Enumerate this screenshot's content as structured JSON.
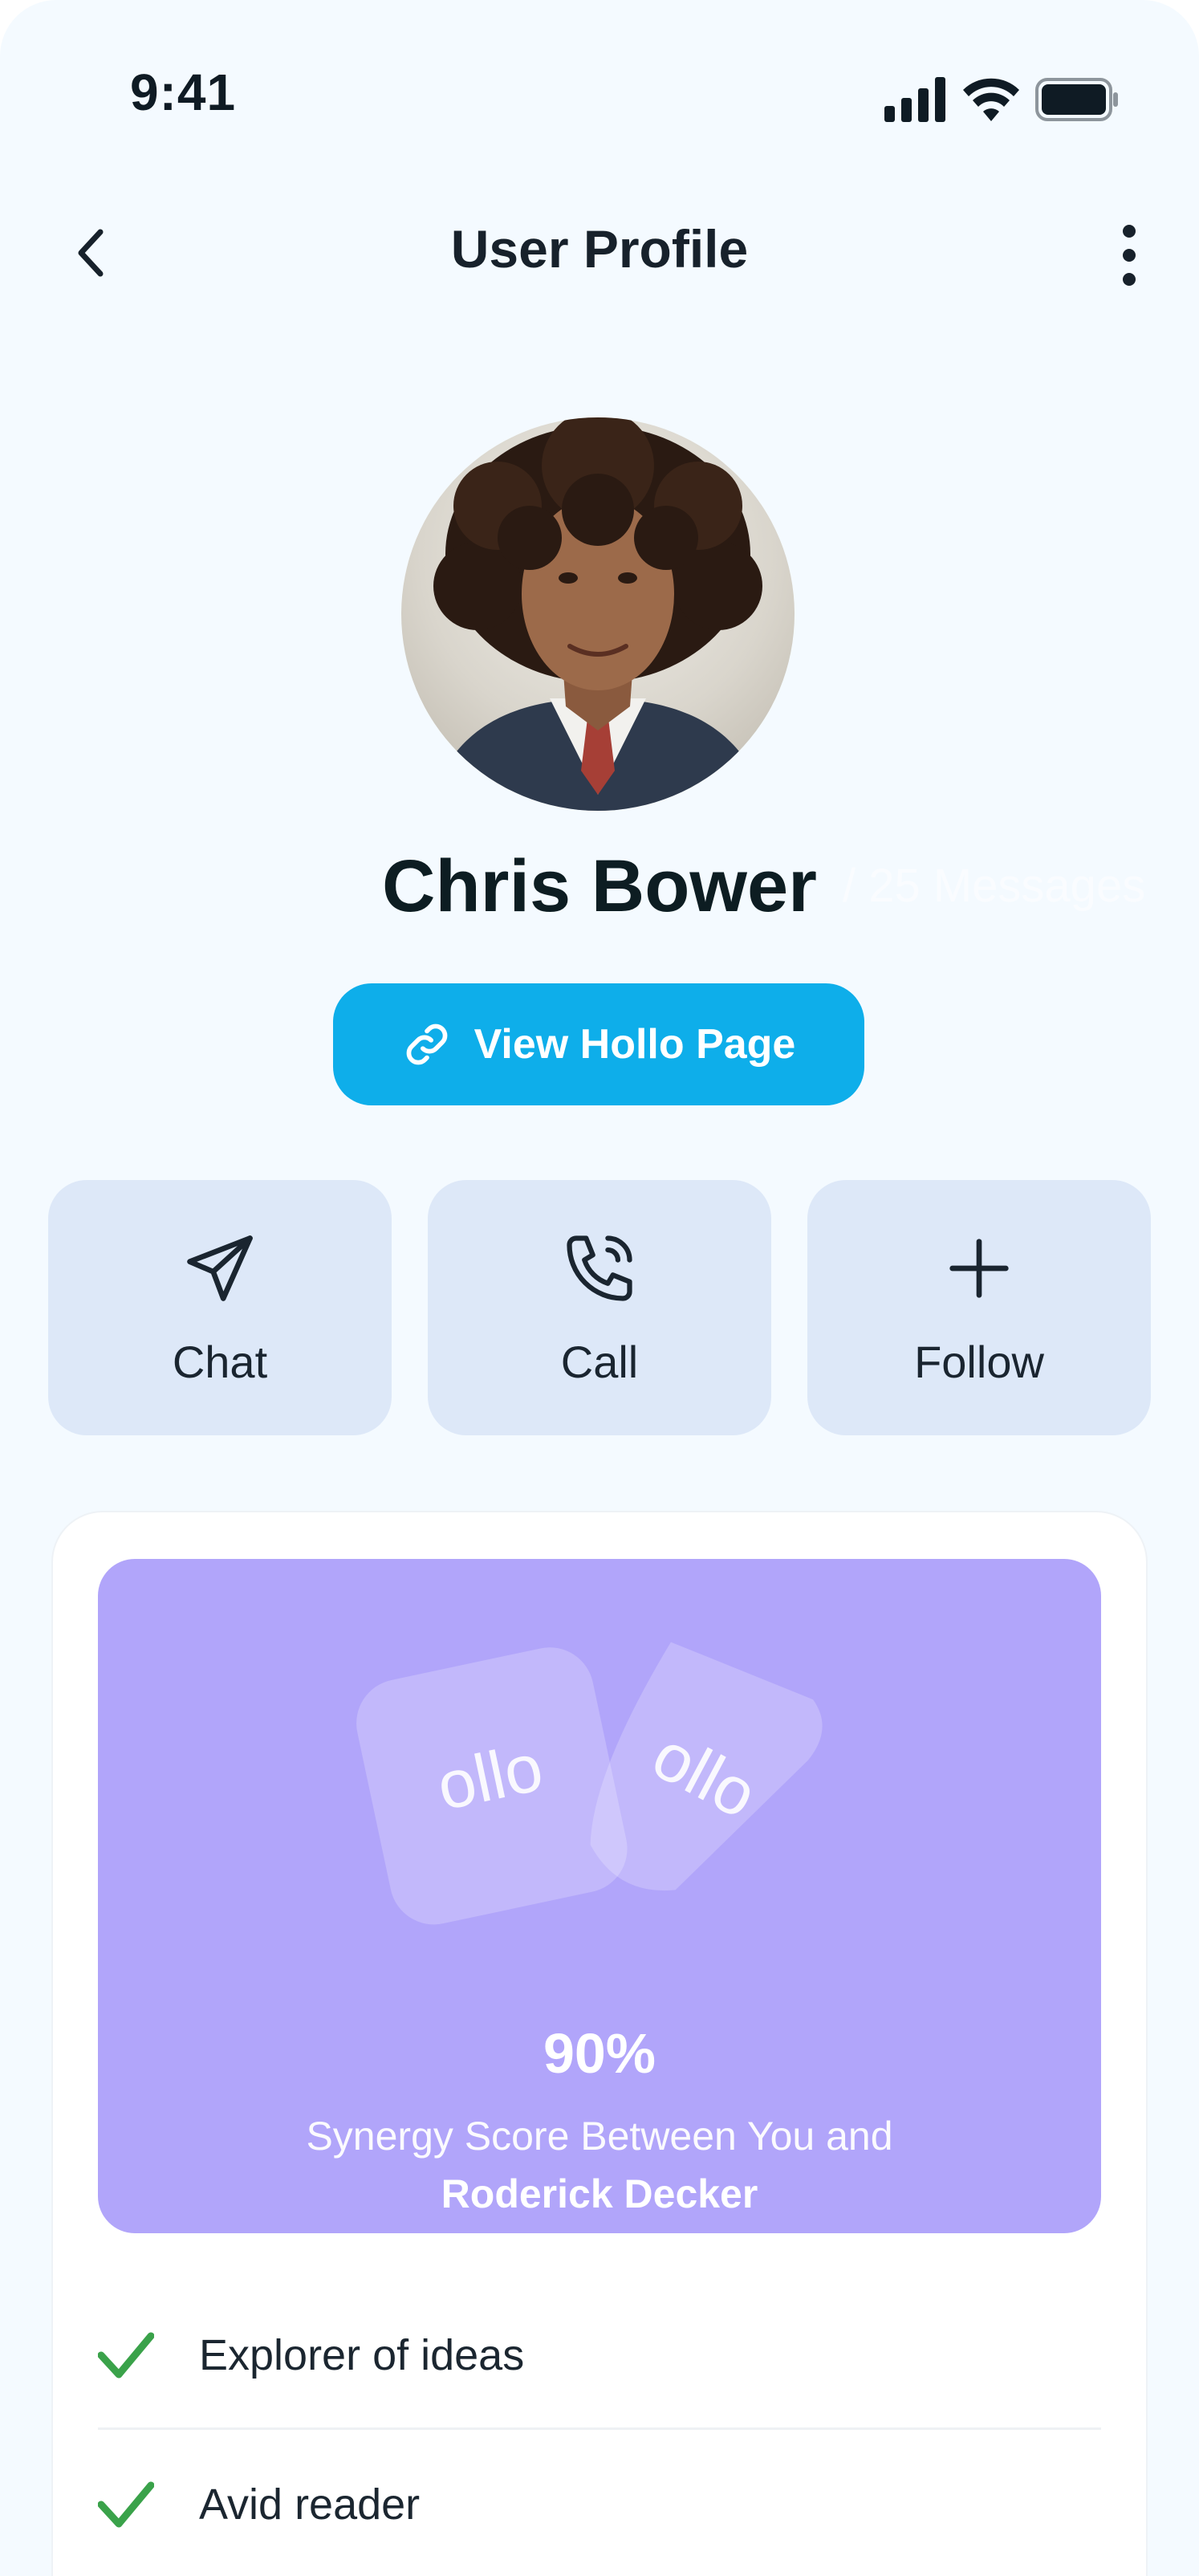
{
  "status_bar": {
    "time": "9:41"
  },
  "header": {
    "title": "User Profile"
  },
  "profile": {
    "name": "Chris Bower",
    "ghost_text": "/ 25 Messages",
    "hollo_button_label": "View Hollo Page"
  },
  "actions": [
    {
      "label": "Chat",
      "icon": "send-icon"
    },
    {
      "label": "Call",
      "icon": "phone-call-icon"
    },
    {
      "label": "Follow",
      "icon": "plus-icon"
    }
  ],
  "synergy": {
    "logo_text": "ollo",
    "score": "90%",
    "line1": "Synergy Score Between You and",
    "line2": "Roderick Decker"
  },
  "traits": [
    {
      "label": "Explorer of ideas"
    },
    {
      "label": "Avid reader"
    }
  ],
  "colors": {
    "accent": "#0eaeea",
    "tile_bg": "#dde8f8",
    "synergy_bg": "#b1a5fa",
    "check": "#3aa24a"
  }
}
